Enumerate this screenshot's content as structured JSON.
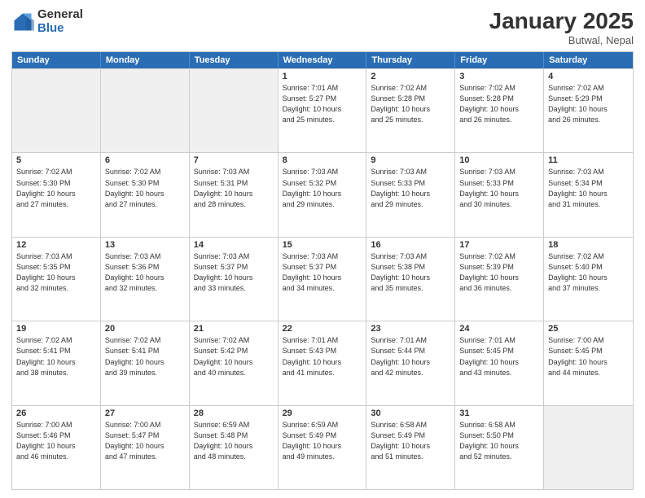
{
  "logo": {
    "general": "General",
    "blue": "Blue"
  },
  "title": "January 2025",
  "subtitle": "Butwal, Nepal",
  "days": [
    "Sunday",
    "Monday",
    "Tuesday",
    "Wednesday",
    "Thursday",
    "Friday",
    "Saturday"
  ],
  "rows": [
    [
      {
        "day": "",
        "lines": []
      },
      {
        "day": "",
        "lines": []
      },
      {
        "day": "",
        "lines": []
      },
      {
        "day": "1",
        "lines": [
          "Sunrise: 7:01 AM",
          "Sunset: 5:27 PM",
          "Daylight: 10 hours",
          "and 25 minutes."
        ]
      },
      {
        "day": "2",
        "lines": [
          "Sunrise: 7:02 AM",
          "Sunset: 5:28 PM",
          "Daylight: 10 hours",
          "and 25 minutes."
        ]
      },
      {
        "day": "3",
        "lines": [
          "Sunrise: 7:02 AM",
          "Sunset: 5:28 PM",
          "Daylight: 10 hours",
          "and 26 minutes."
        ]
      },
      {
        "day": "4",
        "lines": [
          "Sunrise: 7:02 AM",
          "Sunset: 5:29 PM",
          "Daylight: 10 hours",
          "and 26 minutes."
        ]
      }
    ],
    [
      {
        "day": "5",
        "lines": [
          "Sunrise: 7:02 AM",
          "Sunset: 5:30 PM",
          "Daylight: 10 hours",
          "and 27 minutes."
        ]
      },
      {
        "day": "6",
        "lines": [
          "Sunrise: 7:02 AM",
          "Sunset: 5:30 PM",
          "Daylight: 10 hours",
          "and 27 minutes."
        ]
      },
      {
        "day": "7",
        "lines": [
          "Sunrise: 7:03 AM",
          "Sunset: 5:31 PM",
          "Daylight: 10 hours",
          "and 28 minutes."
        ]
      },
      {
        "day": "8",
        "lines": [
          "Sunrise: 7:03 AM",
          "Sunset: 5:32 PM",
          "Daylight: 10 hours",
          "and 29 minutes."
        ]
      },
      {
        "day": "9",
        "lines": [
          "Sunrise: 7:03 AM",
          "Sunset: 5:33 PM",
          "Daylight: 10 hours",
          "and 29 minutes."
        ]
      },
      {
        "day": "10",
        "lines": [
          "Sunrise: 7:03 AM",
          "Sunset: 5:33 PM",
          "Daylight: 10 hours",
          "and 30 minutes."
        ]
      },
      {
        "day": "11",
        "lines": [
          "Sunrise: 7:03 AM",
          "Sunset: 5:34 PM",
          "Daylight: 10 hours",
          "and 31 minutes."
        ]
      }
    ],
    [
      {
        "day": "12",
        "lines": [
          "Sunrise: 7:03 AM",
          "Sunset: 5:35 PM",
          "Daylight: 10 hours",
          "and 32 minutes."
        ]
      },
      {
        "day": "13",
        "lines": [
          "Sunrise: 7:03 AM",
          "Sunset: 5:36 PM",
          "Daylight: 10 hours",
          "and 32 minutes."
        ]
      },
      {
        "day": "14",
        "lines": [
          "Sunrise: 7:03 AM",
          "Sunset: 5:37 PM",
          "Daylight: 10 hours",
          "and 33 minutes."
        ]
      },
      {
        "day": "15",
        "lines": [
          "Sunrise: 7:03 AM",
          "Sunset: 5:37 PM",
          "Daylight: 10 hours",
          "and 34 minutes."
        ]
      },
      {
        "day": "16",
        "lines": [
          "Sunrise: 7:03 AM",
          "Sunset: 5:38 PM",
          "Daylight: 10 hours",
          "and 35 minutes."
        ]
      },
      {
        "day": "17",
        "lines": [
          "Sunrise: 7:02 AM",
          "Sunset: 5:39 PM",
          "Daylight: 10 hours",
          "and 36 minutes."
        ]
      },
      {
        "day": "18",
        "lines": [
          "Sunrise: 7:02 AM",
          "Sunset: 5:40 PM",
          "Daylight: 10 hours",
          "and 37 minutes."
        ]
      }
    ],
    [
      {
        "day": "19",
        "lines": [
          "Sunrise: 7:02 AM",
          "Sunset: 5:41 PM",
          "Daylight: 10 hours",
          "and 38 minutes."
        ]
      },
      {
        "day": "20",
        "lines": [
          "Sunrise: 7:02 AM",
          "Sunset: 5:41 PM",
          "Daylight: 10 hours",
          "and 39 minutes."
        ]
      },
      {
        "day": "21",
        "lines": [
          "Sunrise: 7:02 AM",
          "Sunset: 5:42 PM",
          "Daylight: 10 hours",
          "and 40 minutes."
        ]
      },
      {
        "day": "22",
        "lines": [
          "Sunrise: 7:01 AM",
          "Sunset: 5:43 PM",
          "Daylight: 10 hours",
          "and 41 minutes."
        ]
      },
      {
        "day": "23",
        "lines": [
          "Sunrise: 7:01 AM",
          "Sunset: 5:44 PM",
          "Daylight: 10 hours",
          "and 42 minutes."
        ]
      },
      {
        "day": "24",
        "lines": [
          "Sunrise: 7:01 AM",
          "Sunset: 5:45 PM",
          "Daylight: 10 hours",
          "and 43 minutes."
        ]
      },
      {
        "day": "25",
        "lines": [
          "Sunrise: 7:00 AM",
          "Sunset: 5:45 PM",
          "Daylight: 10 hours",
          "and 44 minutes."
        ]
      }
    ],
    [
      {
        "day": "26",
        "lines": [
          "Sunrise: 7:00 AM",
          "Sunset: 5:46 PM",
          "Daylight: 10 hours",
          "and 46 minutes."
        ]
      },
      {
        "day": "27",
        "lines": [
          "Sunrise: 7:00 AM",
          "Sunset: 5:47 PM",
          "Daylight: 10 hours",
          "and 47 minutes."
        ]
      },
      {
        "day": "28",
        "lines": [
          "Sunrise: 6:59 AM",
          "Sunset: 5:48 PM",
          "Daylight: 10 hours",
          "and 48 minutes."
        ]
      },
      {
        "day": "29",
        "lines": [
          "Sunrise: 6:59 AM",
          "Sunset: 5:49 PM",
          "Daylight: 10 hours",
          "and 49 minutes."
        ]
      },
      {
        "day": "30",
        "lines": [
          "Sunrise: 6:58 AM",
          "Sunset: 5:49 PM",
          "Daylight: 10 hours",
          "and 51 minutes."
        ]
      },
      {
        "day": "31",
        "lines": [
          "Sunrise: 6:58 AM",
          "Sunset: 5:50 PM",
          "Daylight: 10 hours",
          "and 52 minutes."
        ]
      },
      {
        "day": "",
        "lines": []
      }
    ]
  ]
}
